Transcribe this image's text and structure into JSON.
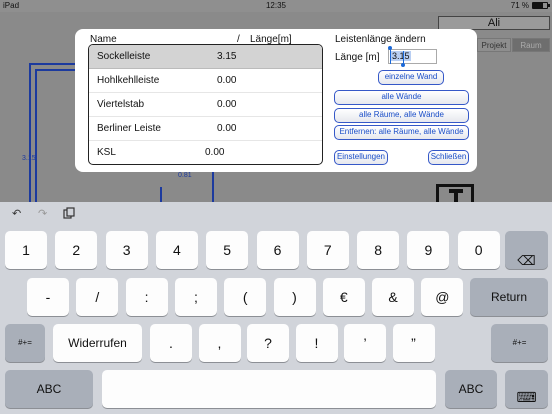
{
  "status_bar": {
    "device": "iPad",
    "time": "12:35",
    "battery_text": "71 %",
    "battery_level": 0.71
  },
  "background": {
    "title": "Ali",
    "tabs": [
      "Projekt",
      "Raum"
    ],
    "plan_labels": [
      "3.15",
      "0.81"
    ]
  },
  "dialog": {
    "list": {
      "header": {
        "name": "Name",
        "slash": "/",
        "length": "Länge[m]"
      },
      "rows": [
        {
          "name": "Sockelleiste",
          "value": "3.15"
        },
        {
          "name": "Hohlkehlleiste",
          "value": "0.00"
        },
        {
          "name": "Viertelstab",
          "value": "0.00"
        },
        {
          "name": "Berliner Leiste",
          "value": "0.00"
        },
        {
          "name": "KSL",
          "value": "0.00"
        }
      ]
    },
    "panel": {
      "title": "Leistenlänge ändern",
      "length_label": "Länge [m]",
      "length_value": "3.15",
      "buttons": {
        "single_wall": "einzelne Wand",
        "all_walls": "alle Wände",
        "all_rooms_all_walls": "alle Räume, alle Wände",
        "remove_all": "Entfernen: alle Räume, alle Wände",
        "settings": "Einstellungen",
        "close": "Schließen"
      }
    }
  },
  "keyboard": {
    "row1": [
      "1",
      "2",
      "3",
      "4",
      "5",
      "6",
      "7",
      "8",
      "9",
      "0"
    ],
    "row2": [
      "-",
      "/",
      ":",
      ";",
      "(",
      ")",
      "€",
      "&",
      "@"
    ],
    "return_label": "Return",
    "symbols_label": "#+=",
    "undo_label": "Widerrufen",
    "row3": [
      ".",
      ",",
      "?",
      "!",
      "’",
      "”"
    ],
    "abc_label": "ABC",
    "icons": {
      "undo": "undo-arrow-icon",
      "redo": "redo-arrow-icon",
      "paste": "paste-icon",
      "delete": "delete-backspace-icon",
      "dismiss": "keyboard-dismiss-icon"
    }
  }
}
